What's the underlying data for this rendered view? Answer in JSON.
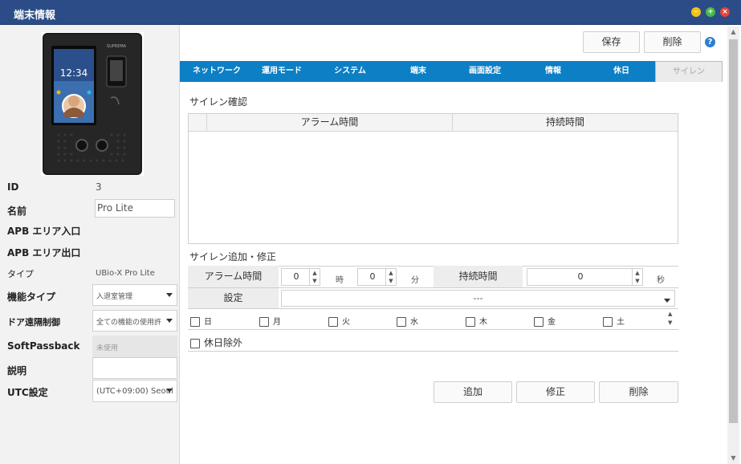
{
  "window": {
    "title": "端末情報"
  },
  "device_screen": {
    "time": "12:34",
    "brand": "SUPREMA"
  },
  "left": {
    "id_label": "ID",
    "id_value": "3",
    "name_label": "名前",
    "name_value": "Pro Lite",
    "apb_in_label": "APB エリア入口",
    "apb_out_label": "APB エリア出口",
    "type_label": "タイプ",
    "type_value": "UBio-X Pro Lite",
    "func_type_label": "機能タイプ",
    "func_type_value": "入退室管理",
    "door_label": "ドア遠隔制御",
    "door_value": "全ての機能の使用許",
    "softpass_label": "SoftPassback",
    "softpass_value": "未使用",
    "desc_label": "説明",
    "desc_value": "",
    "utc_label": "UTC設定",
    "utc_value": "(UTC+09:00) Seoul"
  },
  "toolbar": {
    "save_label": "保存",
    "delete_label": "削除",
    "help_icon": "?"
  },
  "tabs": [
    {
      "label": "ネットワーク"
    },
    {
      "label": "運用モード"
    },
    {
      "label": "システム"
    },
    {
      "label": "端末"
    },
    {
      "label": "画面設定"
    },
    {
      "label": "情報"
    },
    {
      "label": "休日"
    },
    {
      "label": "サイレン"
    }
  ],
  "siren_confirm": {
    "title": "サイレン確認",
    "columns": [
      "アラーム時間",
      "持続時間"
    ]
  },
  "siren_edit": {
    "title": "サイレン追加・修正",
    "alarm_time_label": "アラーム時間",
    "hour_value": "0",
    "hour_unit": "時",
    "minute_value": "0",
    "minute_unit": "分",
    "duration_label": "持続時間",
    "duration_value": "0",
    "duration_unit": "秒",
    "setting_label": "設定",
    "setting_value": "---",
    "days": [
      "日",
      "月",
      "火",
      "水",
      "木",
      "金",
      "土"
    ],
    "exclude_holiday_label": "休日除外"
  },
  "actions": {
    "add_label": "追加",
    "modify_label": "修正",
    "delete_label": "削除"
  }
}
